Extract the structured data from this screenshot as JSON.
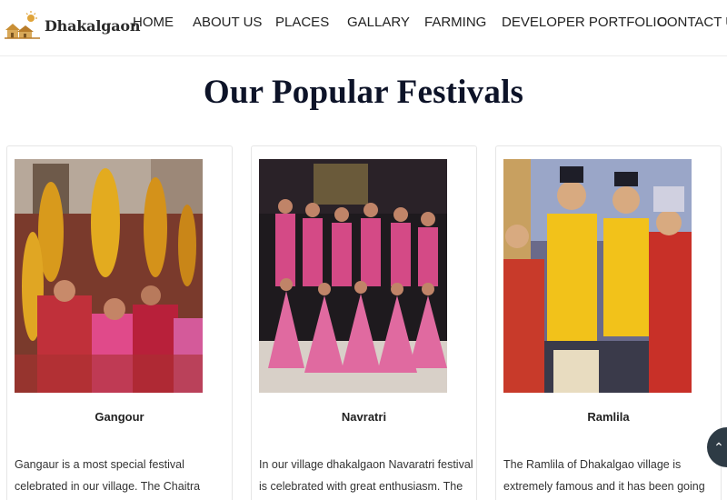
{
  "brand": {
    "name": "Dhakalgaon"
  },
  "nav": {
    "home": "HOME",
    "about": "ABOUT US",
    "places": "PLACES",
    "gallery": "GALLARY",
    "farming": "FARMING",
    "portfolio": "DEVELOPER PORTFOLIO",
    "contact": "CONTACT US"
  },
  "section": {
    "title": "Our Popular Festivals"
  },
  "cards": [
    {
      "title": "Gangour",
      "text": "Gangaur is a most special festival celebrated in our village. The Chaitra Gangaur festival begins with"
    },
    {
      "title": "Navratri",
      "text": "In our village dhakalgaon Navaratri festival is celebrated with great enthusiasm. The Garba event in"
    },
    {
      "title": "Ramlila",
      "text": "The Ramlila of Dhakalgao village is extremely famous and it has been going on since the time of our"
    }
  ],
  "scroll_top": {
    "icon": "chevron-up-icon"
  },
  "colors": {
    "title": "#0d1328",
    "scroll_button": "#2e3b45"
  }
}
